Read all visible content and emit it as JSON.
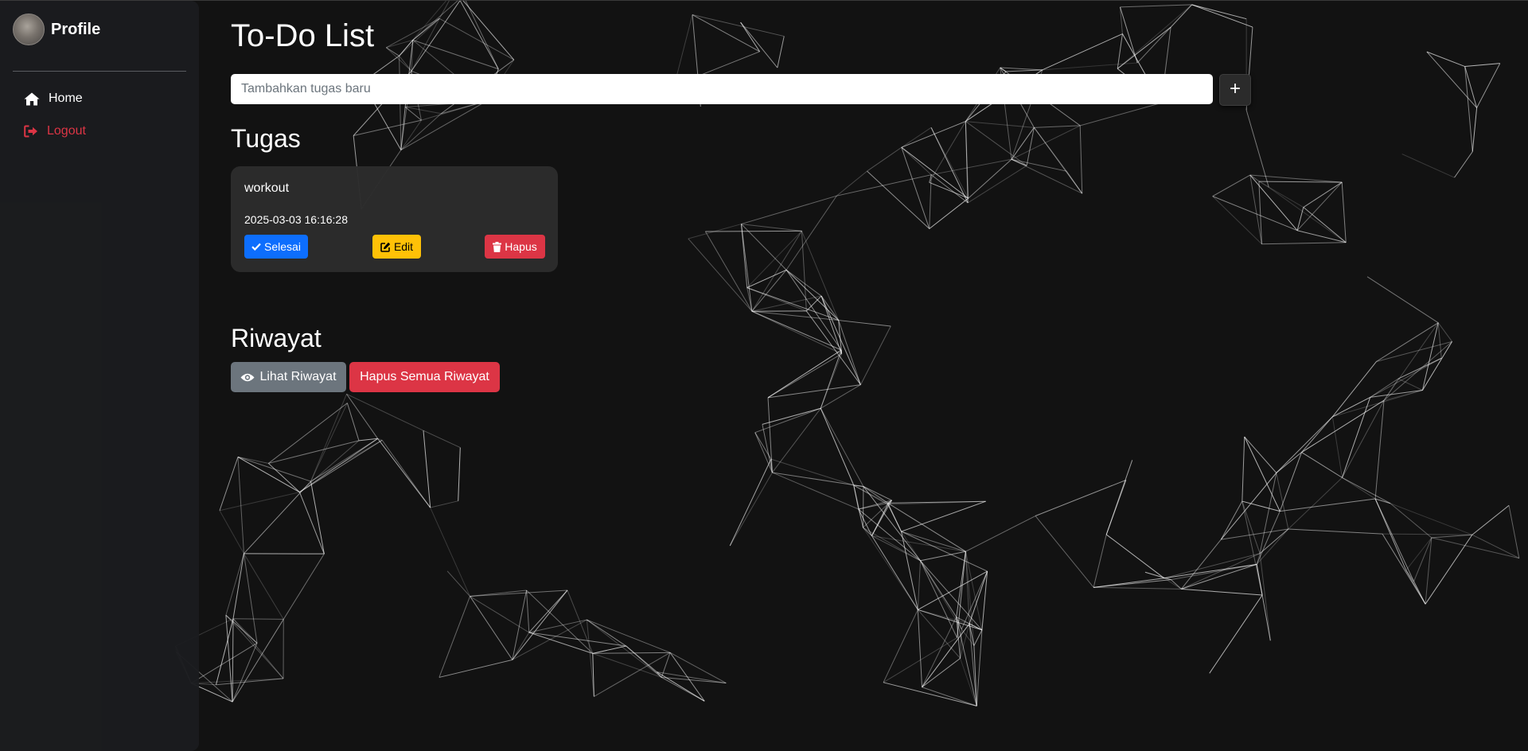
{
  "sidebar": {
    "profile_name": "Profile",
    "items": [
      {
        "label": "Home",
        "icon": "home-icon"
      },
      {
        "label": "Logout",
        "icon": "logout-icon"
      }
    ]
  },
  "main": {
    "title": "To-Do List",
    "input": {
      "placeholder": "Tambahkan tugas baru",
      "value": ""
    },
    "add_button": "+",
    "tasks_heading": "Tugas",
    "tasks": [
      {
        "title": "workout",
        "timestamp": "2025-03-03 16:16:28",
        "done_label": "Selesai",
        "edit_label": "Edit",
        "delete_label": "Hapus"
      }
    ],
    "history_heading": "Riwayat",
    "view_history_label": "Lihat Riwayat",
    "clear_history_label": "Hapus Semua Riwayat"
  },
  "colors": {
    "background": "#121212",
    "sidebar": "#1b1c1f",
    "primary": "#0d6efd",
    "warning": "#ffc107",
    "danger": "#dc3545",
    "secondary": "#6c757d"
  }
}
